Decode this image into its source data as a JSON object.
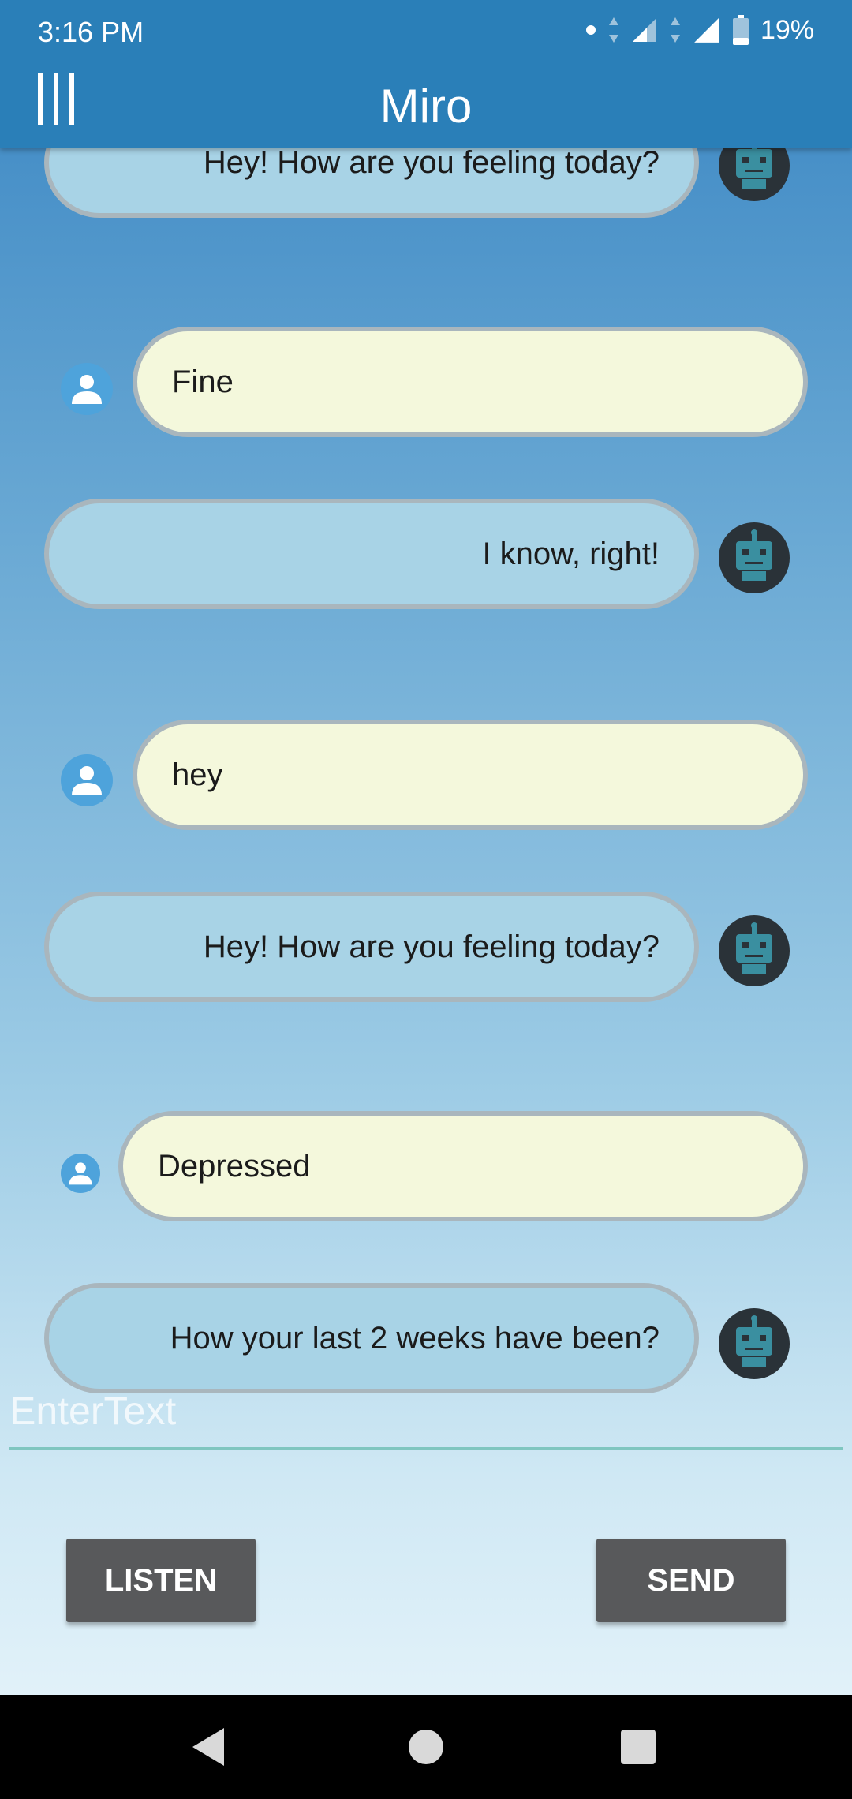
{
  "status_bar": {
    "time": "3:16 PM",
    "battery": "19%",
    "icons": [
      "notification-dot-icon",
      "data-arrows-icon",
      "signal-icon",
      "battery-icon"
    ]
  },
  "app_bar": {
    "title": "Miro",
    "menu_icon": "menu-icon"
  },
  "messages": [
    {
      "sender": "bot",
      "text": "Hey! How are you feeling today?"
    },
    {
      "sender": "user",
      "text": "Fine"
    },
    {
      "sender": "bot",
      "text": "I know, right!"
    },
    {
      "sender": "user",
      "text": "hey"
    },
    {
      "sender": "bot",
      "text": "Hey! How are you feeling today?"
    },
    {
      "sender": "user",
      "text": "Depressed"
    },
    {
      "sender": "bot",
      "text": "How your last 2 weeks have been?"
    }
  ],
  "input": {
    "placeholder": "EnterText",
    "value": ""
  },
  "buttons": {
    "listen": "LISTEN",
    "send": "SEND"
  },
  "colors": {
    "app_bar": "#2a7fb8",
    "bot_bubble": "#a8d3e6",
    "user_bubble": "#f4f8dc",
    "button": "#58595b",
    "input_underline": "#7fc6c0"
  }
}
